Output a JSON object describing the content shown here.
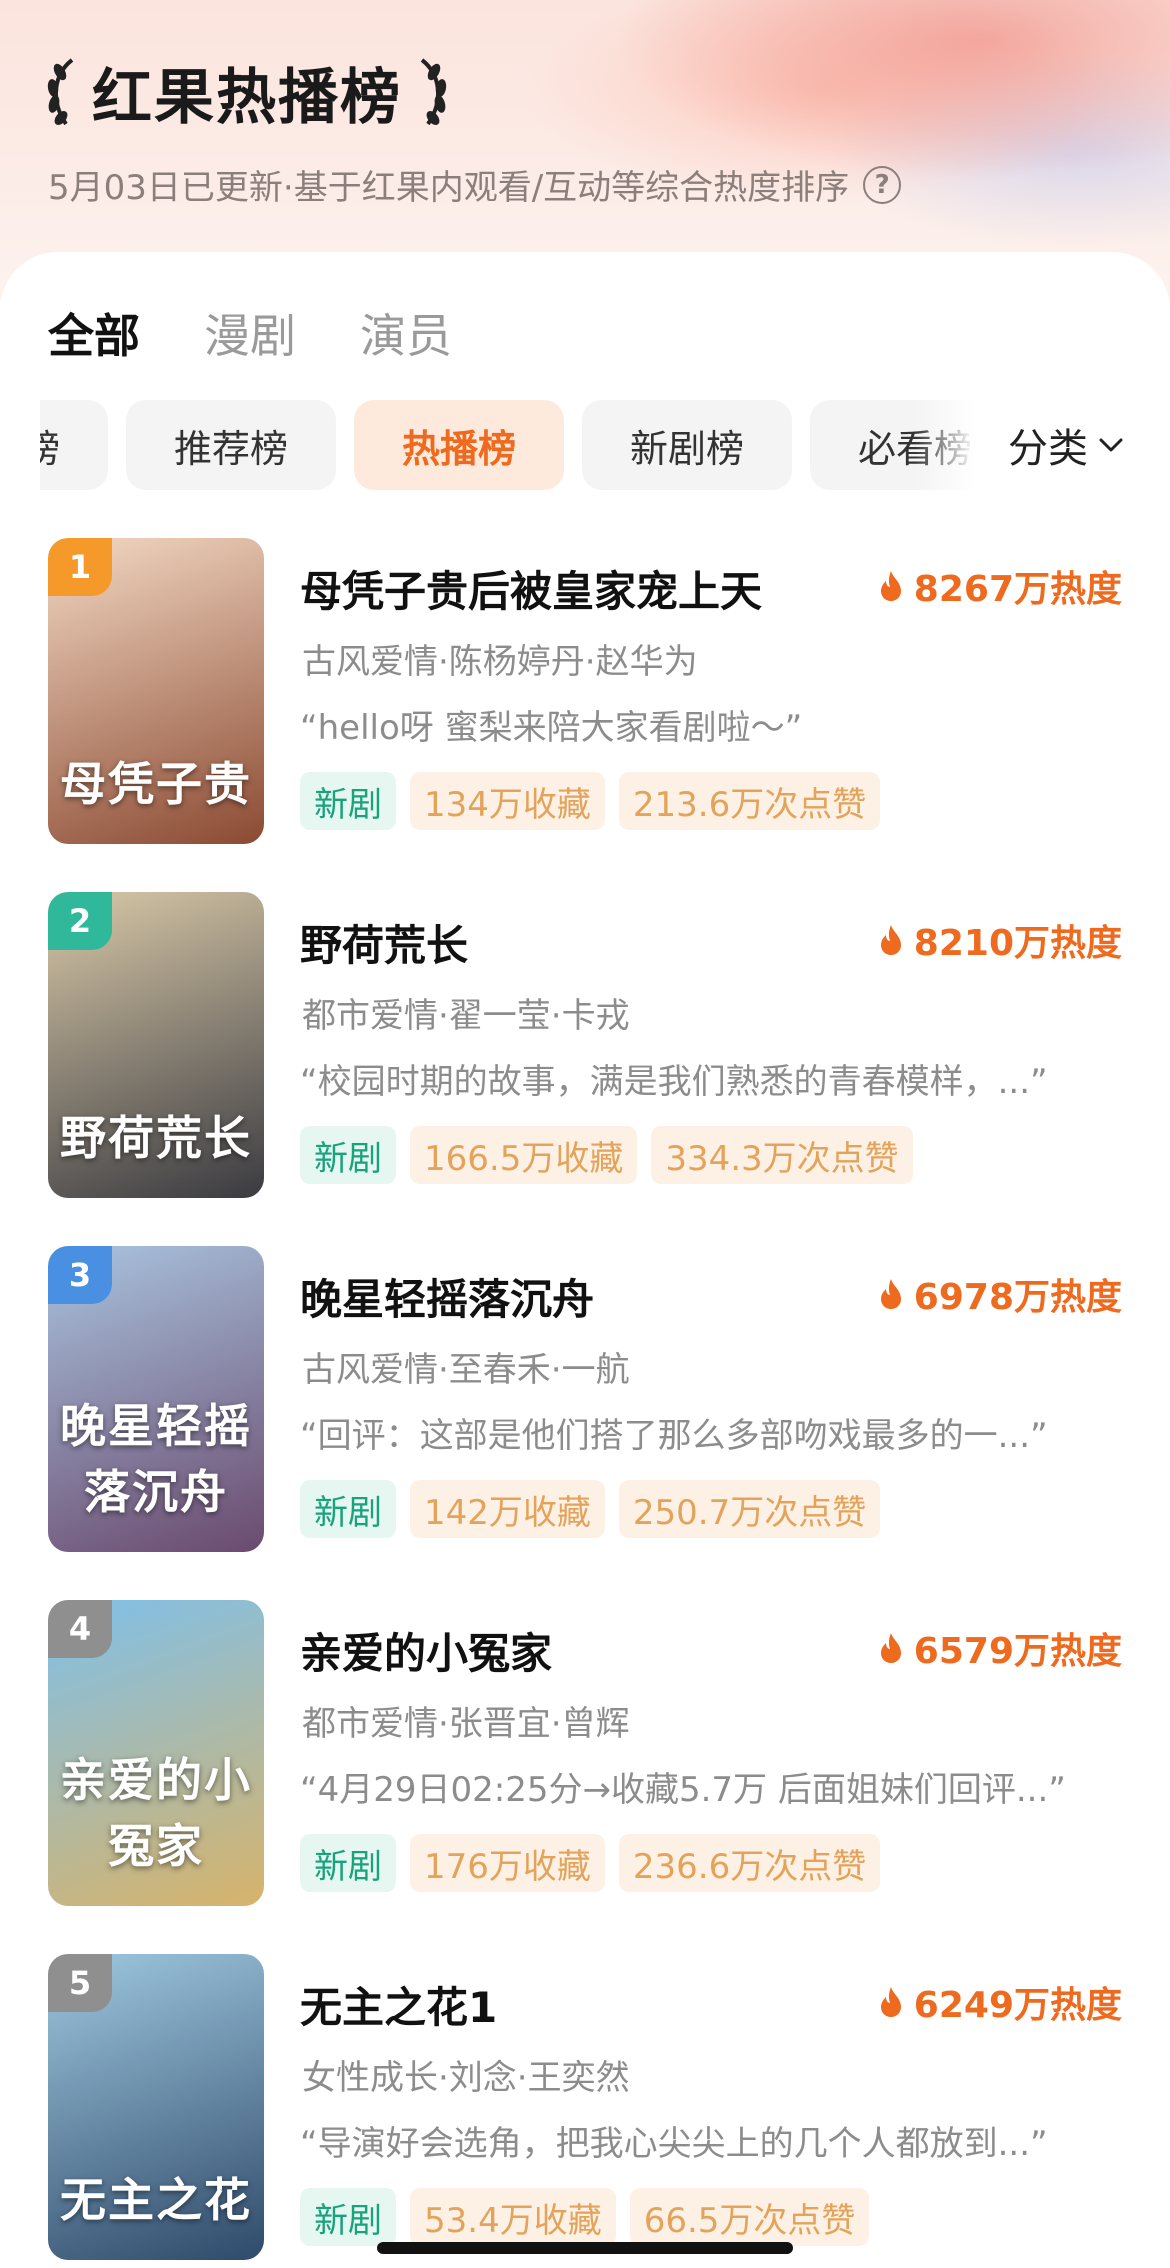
{
  "header": {
    "title": "红果热播榜",
    "subtitle": "5月03日已更新·基于红果内观看/互动等综合热度排序"
  },
  "tabs": [
    {
      "label": "全部",
      "active": true
    },
    {
      "label": "漫剧",
      "active": false
    },
    {
      "label": "演员",
      "active": false
    }
  ],
  "chips": [
    {
      "label": "口碑榜",
      "active": false
    },
    {
      "label": "推荐榜",
      "active": false
    },
    {
      "label": "热播榜",
      "active": true
    },
    {
      "label": "新剧榜",
      "active": false
    },
    {
      "label": "必看榜",
      "active": false
    }
  ],
  "category_label": "分类",
  "accent_color": "#ee6a1f",
  "items": [
    {
      "rank": "1",
      "rank_color": "#f59a2a",
      "title": "母凭子贵后被皇家宠上天",
      "poster_text": "母凭子贵",
      "poster_colors": [
        "#f3d9c4",
        "#8b4a32"
      ],
      "heat": "8267万热度",
      "meta": "古风爱情·陈杨婷丹·赵华为",
      "quote": "“hello呀 蜜梨来陪大家看剧啦～”",
      "tag_new": "新剧",
      "favorites": "134万收藏",
      "likes": "213.6万次点赞"
    },
    {
      "rank": "2",
      "rank_color": "#2fb89a",
      "title": "野荷荒长",
      "poster_text": "野荷荒长",
      "poster_colors": [
        "#d9c9a8",
        "#3a3a40"
      ],
      "heat": "8210万热度",
      "meta": "都市爱情·翟一莹·卡戎",
      "quote": "“校园时期的故事，满是我们熟悉的青春模样，...”",
      "tag_new": "新剧",
      "favorites": "166.5万收藏",
      "likes": "334.3万次点赞"
    },
    {
      "rank": "3",
      "rank_color": "#4a90e2",
      "title": "晚星轻摇落沉舟",
      "poster_text": "晚星轻摇落沉舟",
      "poster_colors": [
        "#a9c4df",
        "#6a4a6e"
      ],
      "heat": "6978万热度",
      "meta": "古风爱情·至春禾·一航",
      "quote": "“回评：这部是他们搭了那么多部吻戏最多的一...”",
      "tag_new": "新剧",
      "favorites": "142万收藏",
      "likes": "250.7万次点赞"
    },
    {
      "rank": "4",
      "rank_color": "#8f8f8f",
      "title": "亲爱的小冤家",
      "poster_text": "亲爱的小冤家",
      "poster_colors": [
        "#7fc0ea",
        "#d7b36a"
      ],
      "heat": "6579万热度",
      "meta": "都市爱情·张晋宜·曾辉",
      "quote": "“4月29日02:25分→收藏5.7万 后面姐妹们回评...”",
      "tag_new": "新剧",
      "favorites": "176万收藏",
      "likes": "236.6万次点赞"
    },
    {
      "rank": "5",
      "rank_color": "#8f8f8f",
      "title": "无主之花1",
      "poster_text": "无主之花",
      "poster_colors": [
        "#9fc8e0",
        "#2f4a6a"
      ],
      "heat": "6249万热度",
      "meta": "女性成长·刘念·王奕然",
      "quote": "“导演好会选角，把我心尖尖上的几个人都放到...”",
      "tag_new": "新剧",
      "favorites": "53.4万收藏",
      "likes": "66.5万次点赞"
    }
  ]
}
